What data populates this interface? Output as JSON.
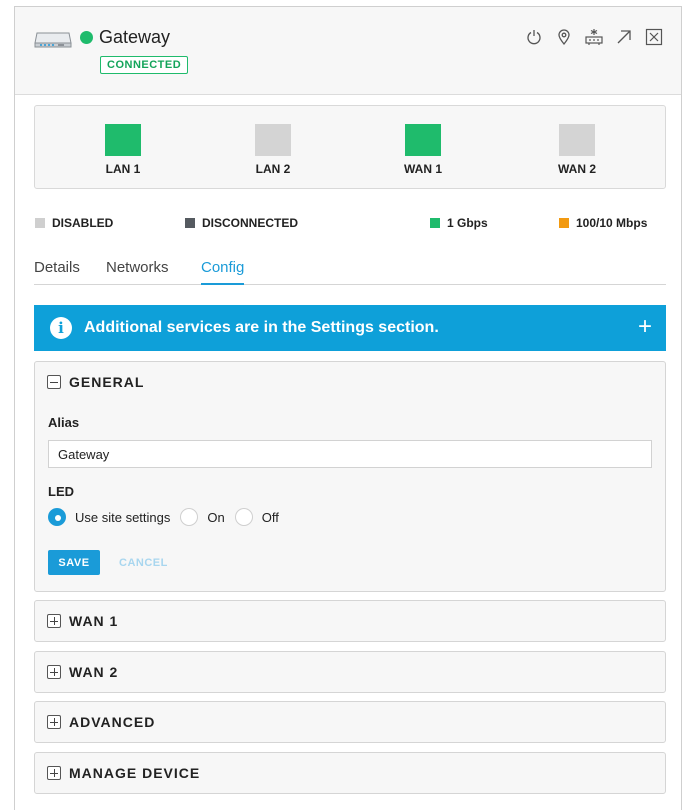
{
  "header": {
    "device_name": "Gateway",
    "status_badge": "CONNECTED",
    "status_color": "#1fbb6c",
    "actions": [
      "power-icon",
      "locate-icon",
      "network-device-icon",
      "open-external-icon",
      "close-icon"
    ]
  },
  "ports": [
    {
      "label": "LAN 1",
      "state": "1 Gbps",
      "color": "#1fbb6c"
    },
    {
      "label": "LAN 2",
      "state": "DISABLED",
      "color": "#d4d4d4"
    },
    {
      "label": "WAN 1",
      "state": "1 Gbps",
      "color": "#1fbb6c"
    },
    {
      "label": "WAN 2",
      "state": "DISABLED",
      "color": "#d4d4d4"
    }
  ],
  "legend": [
    {
      "label": "DISABLED",
      "color": "#cfcfcf"
    },
    {
      "label": "DISCONNECTED",
      "color": "#555a60"
    },
    {
      "label": "1 Gbps",
      "color": "#1fbb6c"
    },
    {
      "label": "100/10 Mbps",
      "color": "#f29a11"
    }
  ],
  "tabs": [
    {
      "label": "Details",
      "active": false
    },
    {
      "label": "Networks",
      "active": false
    },
    {
      "label": "Config",
      "active": true
    }
  ],
  "banner": {
    "text": "Additional services are in the Settings section.",
    "color": "#0ea0d9"
  },
  "general": {
    "title": "GENERAL",
    "alias_label": "Alias",
    "alias_value": "Gateway",
    "led_label": "LED",
    "led_options": [
      "Use site settings",
      "On",
      "Off"
    ],
    "led_selected": "Use site settings",
    "save_label": "SAVE",
    "cancel_label": "CANCEL"
  },
  "collapsed_sections": [
    "WAN 1",
    "WAN 2",
    "ADVANCED",
    "MANAGE DEVICE"
  ],
  "accent_color": "#1a9bd8"
}
